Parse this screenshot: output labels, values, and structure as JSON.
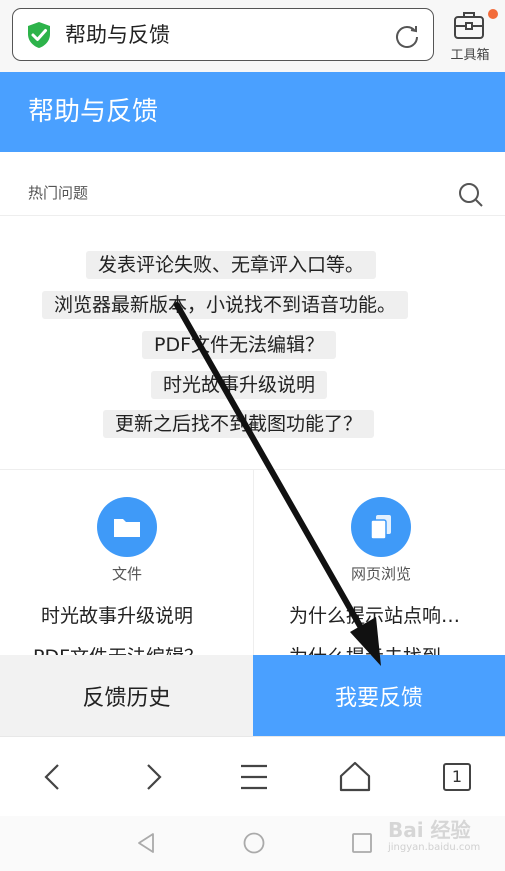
{
  "browser": {
    "address_text": "帮助与反馈",
    "toolbox_label": "工具箱",
    "icons": {
      "secure": "shield-check-icon",
      "reload": "refresh-icon",
      "toolbox": "toolbox-icon"
    }
  },
  "header": {
    "title": "帮助与反馈"
  },
  "hot": {
    "label": "热门问题",
    "questions": [
      "发表评论失败、无章评入口等。",
      "浏览器最新版本，小说找不到语音功能。",
      "PDF文件无法编辑？",
      "时光故事升级说明",
      "更新之后找不到截图功能了？"
    ]
  },
  "categories": [
    {
      "label": "文件",
      "icon": "folder-icon",
      "items": [
        "时光故事升级说明",
        "PDF文件无法编辑？"
      ]
    },
    {
      "label": "网页浏览",
      "icon": "pages-icon",
      "items": [
        "为什么提示站点响…",
        "为什么提示未找到…"
      ]
    }
  ],
  "buttons": {
    "history": "反馈历史",
    "feedback": "我要反馈"
  },
  "navbar": {
    "tab_count": "1"
  },
  "watermark": {
    "text": "Bai 经验",
    "sub": "jingyan.baidu.com"
  },
  "colors": {
    "accent": "#4aa0ff",
    "secure_green": "#2db34a",
    "badge": "#f26b3a"
  }
}
